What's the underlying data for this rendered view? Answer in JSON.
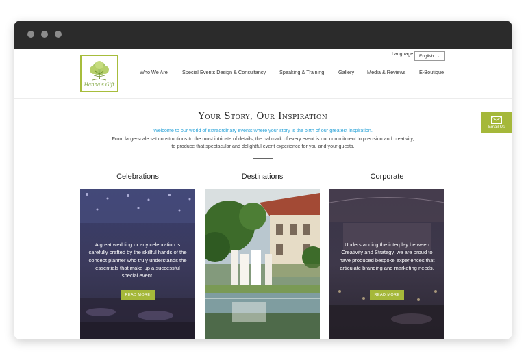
{
  "header": {
    "logo_text": "Hanna's Gift",
    "language_label": "Language",
    "language_value": "English",
    "nav": [
      "Who We Are",
      "Special Events Design & Consultancy",
      "Speaking & Training",
      "Gallery",
      "Media & Reviews",
      "E-Boutique"
    ]
  },
  "intro": {
    "title": "Your Story, Our Inspiration",
    "welcome": "Welcome to our world of extraordinary events where your story is the birth of our greatest inspiration.",
    "description": "From large-scale set constructions to the most intricate of details, the hallmark of every event is our commitment to precision and creativity, to produce that spectacular and delightful event experience for you and your guests."
  },
  "email_button": {
    "label": "Email Us"
  },
  "sections": [
    {
      "title": "Celebrations",
      "text": "A great wedding or any celebration is carefully crafted by the skillful hands of the concept planner who truly understands the essentials that make up a successful special event.",
      "button": "READ MORE"
    },
    {
      "title": "Destinations"
    },
    {
      "title": "Corporate",
      "text": "Understanding the interplay between Creativity and Strategy, we are proud to have produced bespoke experiences that articulate branding and marketing needs.",
      "button": "READ MORE"
    }
  ],
  "colors": {
    "accent": "#a5b83a",
    "link": "#2aa3d8",
    "chrome": "#2b2b2b"
  }
}
